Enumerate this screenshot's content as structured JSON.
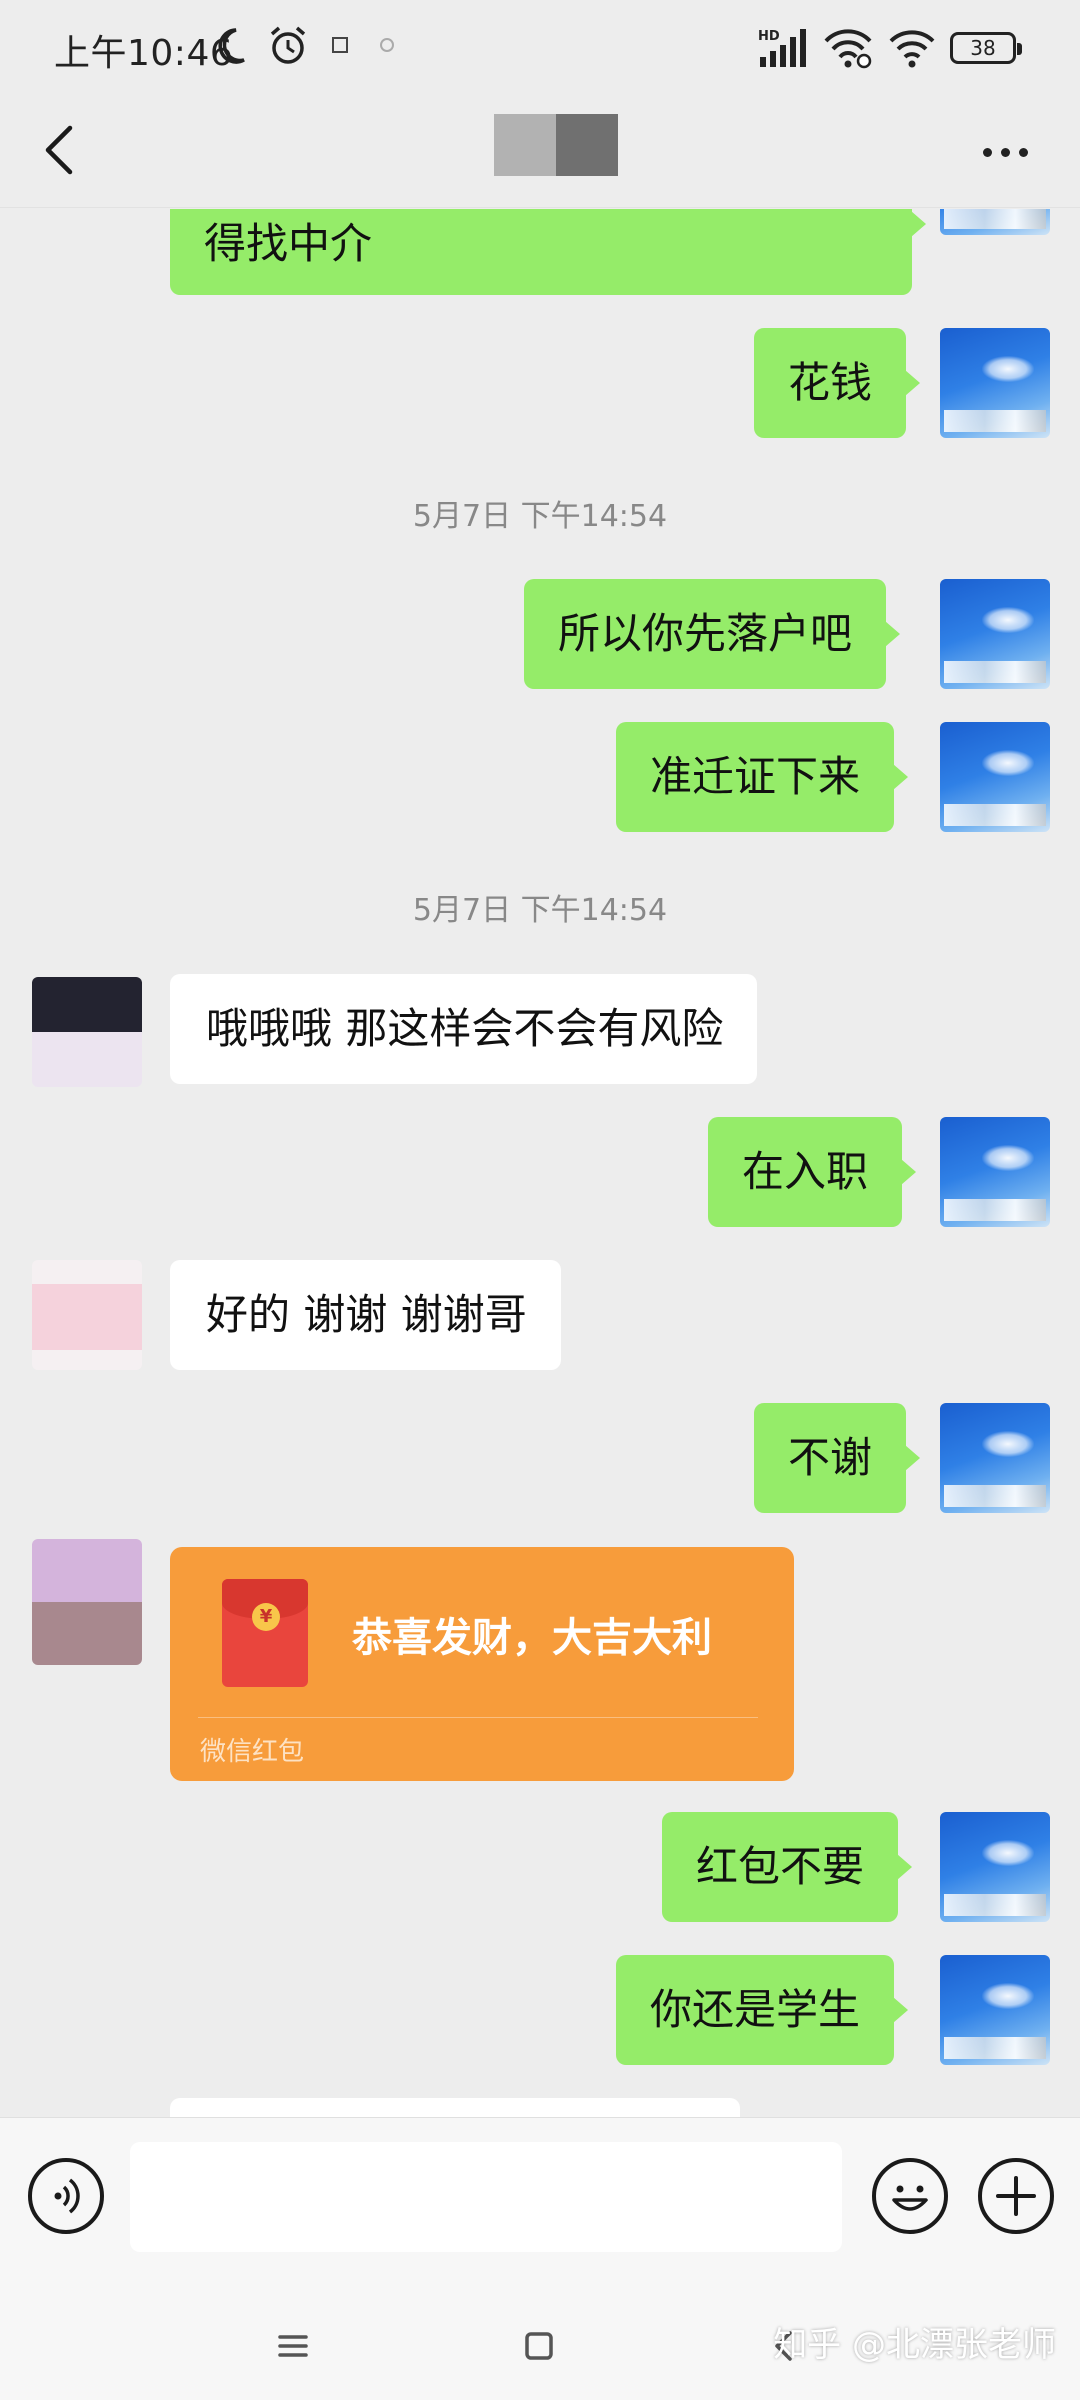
{
  "status_bar": {
    "time": "上午10:46",
    "network": "HD",
    "battery": "38"
  },
  "nav": {
    "title": ""
  },
  "messages": {
    "m0": "得找中介",
    "m1": "花钱",
    "ts1": "5月7日 下午14:54",
    "m2": "所以你先落户吧",
    "m3": "准迁证下来",
    "ts2": "5月7日 下午14:54",
    "m4": "哦哦哦 那这样会不会有风险",
    "m5": "在入职",
    "m6": "好的 谢谢 谢谢哥",
    "m7": "不谢",
    "m9": "红包不要",
    "m10": "你还是学生"
  },
  "red_packet": {
    "title": "恭喜发财，大吉大利",
    "footer": "微信红包",
    "symbol": "¥"
  },
  "input": {
    "placeholder": ""
  },
  "watermark": "知乎 @北漂张老师",
  "colors": {
    "outgoing_bubble": "#95ec69",
    "incoming_bubble": "#ffffff",
    "red_packet": "#f79c3b",
    "background": "#ededed"
  }
}
